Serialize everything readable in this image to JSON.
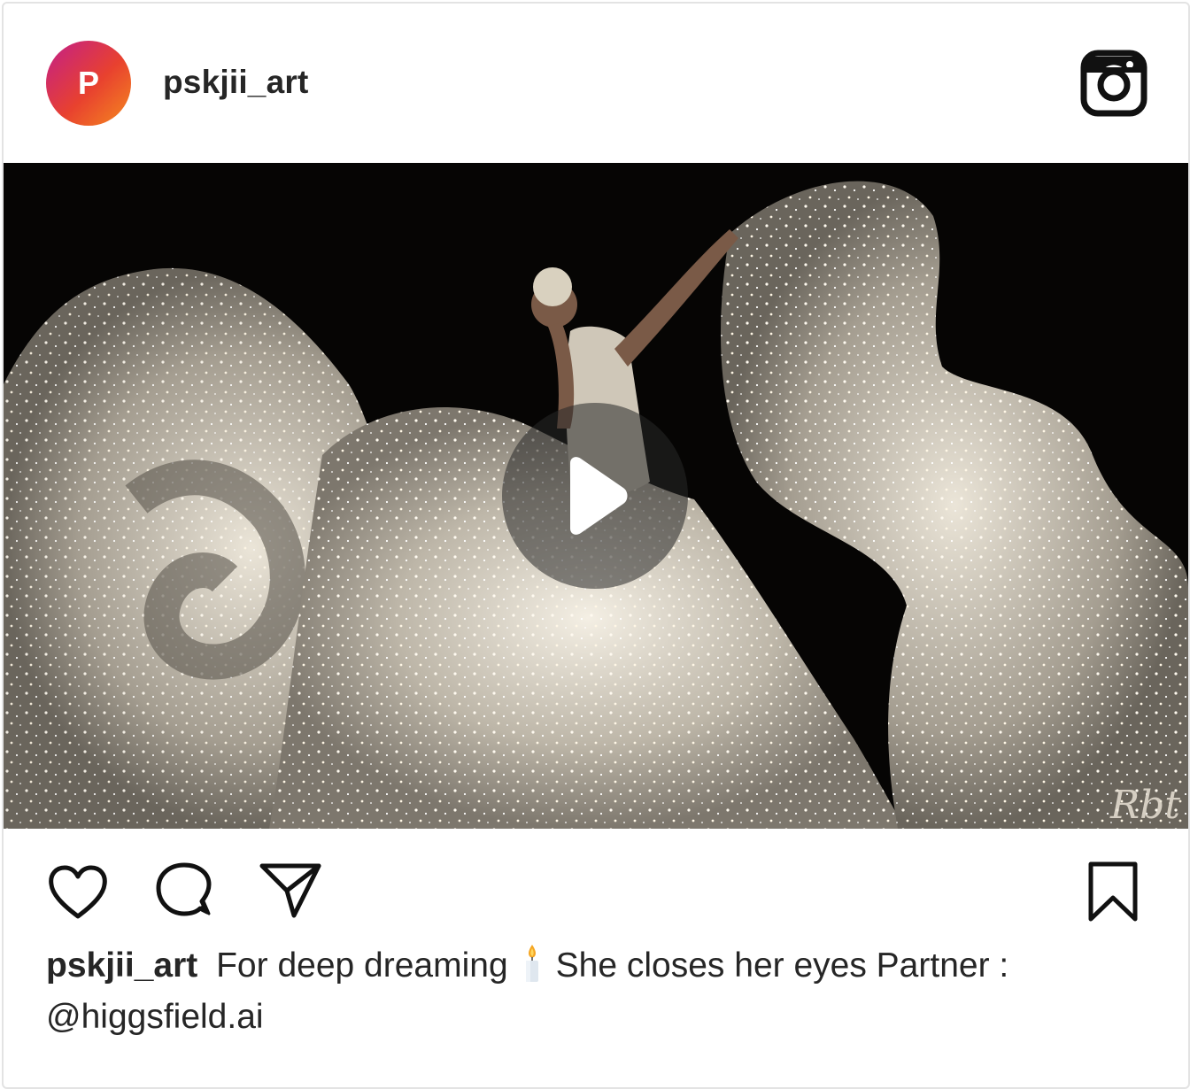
{
  "post": {
    "avatar_initial": "P",
    "username": "pskjii_art",
    "caption_user": "pskjii_art",
    "caption_text_1": "For deep dreaming",
    "caption_emoji": "candle",
    "caption_text_2": "She closes her eyes Partner :",
    "caption_mention": "@higgsfield.ai",
    "media_type": "video",
    "media_watermark": "Rbt"
  },
  "icons": {
    "platform": "instagram-icon",
    "play": "play-icon",
    "like": "heart-icon",
    "comment": "comment-bubble-icon",
    "share": "paper-plane-icon",
    "save": "bookmark-icon"
  },
  "colors": {
    "avatar_gradient_start": "#c21f8a",
    "avatar_gradient_end": "#f58a1f",
    "text": "#262626",
    "border": "#e3e3e3"
  }
}
